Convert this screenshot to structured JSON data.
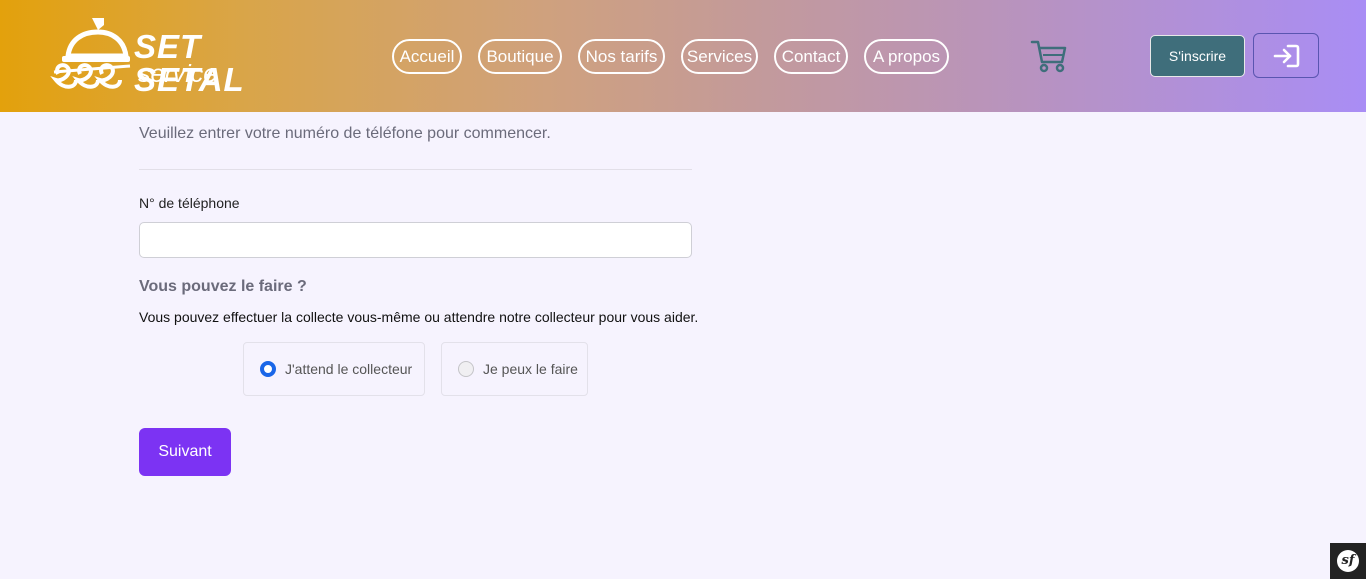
{
  "brand": {
    "name_line1": "SET SETAL",
    "name_line2": "service"
  },
  "nav": {
    "items": [
      "Accueil",
      "Boutique",
      "Nos tarifs",
      "Services",
      "Contact",
      "A propos"
    ]
  },
  "header": {
    "signup_label": "S'inscrire"
  },
  "form": {
    "intro": "Veuillez entrer votre numéro de téléfone pour commencer.",
    "phone_label": "N° de téléphone",
    "phone_value": "",
    "question": "Vous pouvez le faire ?",
    "explanation": "Vous pouvez effectuer la collecte vous-même ou attendre notre collecteur pour vous aider.",
    "options": [
      {
        "label": "J'attend le collecteur",
        "selected": true
      },
      {
        "label": "Je peux le faire",
        "selected": false
      }
    ],
    "next_label": "Suivant"
  },
  "colors": {
    "accent": "#7c33f3",
    "signup_bg": "#3f6e7b",
    "radio_selected": "#1a66e8",
    "cart_icon": "#3f6e7b"
  },
  "icons": {
    "cart": "shopping-cart-icon",
    "login": "login-arrow-icon",
    "debug": "symfony-icon"
  }
}
